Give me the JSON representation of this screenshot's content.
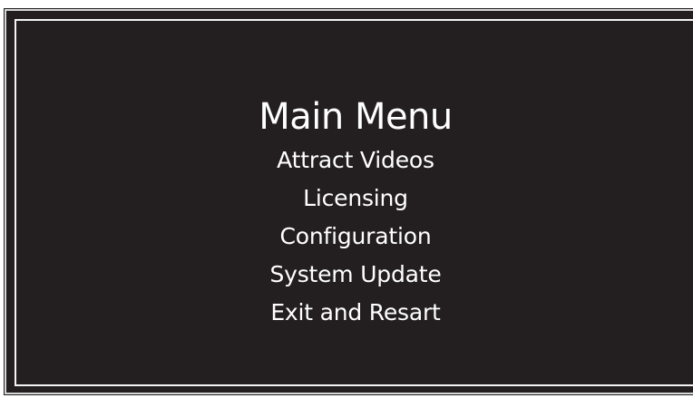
{
  "menu": {
    "title": "Main Menu",
    "items": [
      {
        "label": "Attract Videos"
      },
      {
        "label": "Licensing"
      },
      {
        "label": "Configuration"
      },
      {
        "label": "System Update"
      },
      {
        "label": "Exit and Resart"
      }
    ]
  },
  "colors": {
    "background": "#231f20",
    "text": "#ffffff",
    "border": "#f4f4f4"
  }
}
